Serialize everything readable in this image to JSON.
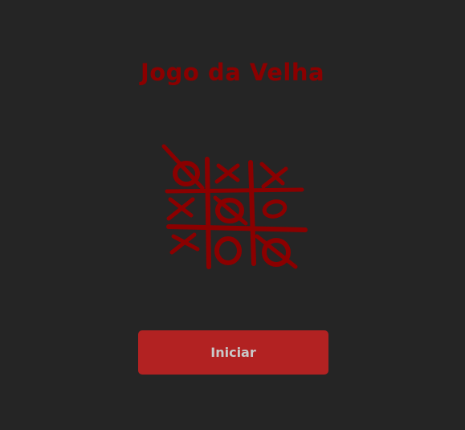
{
  "header": {
    "title": "Jogo da Velha"
  },
  "logo": {
    "icon": "tic-tac-toe-board-icon",
    "color": "#8b0000",
    "cells": [
      "O",
      "X",
      "X",
      "X",
      "O",
      "O",
      "X",
      "O",
      "O"
    ]
  },
  "actions": {
    "start_label": "Iniciar"
  },
  "colors": {
    "background": "#252525",
    "accent": "#8b0000",
    "button": "#b22222",
    "button_text": "#c9c9c9"
  }
}
